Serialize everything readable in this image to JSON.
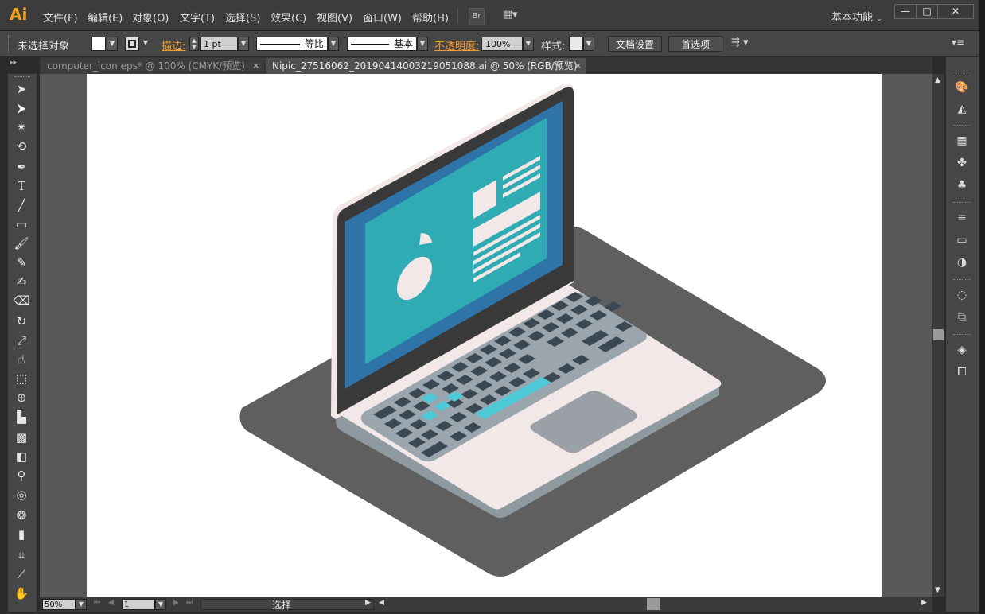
{
  "app": {
    "logo": "Ai"
  },
  "menu": [
    "文件(F)",
    "编辑(E)",
    "对象(O)",
    "文字(T)",
    "选择(S)",
    "效果(C)",
    "视图(V)",
    "窗口(W)",
    "帮助(H)"
  ],
  "menubar_buttons": {
    "bridge": "Br",
    "arrange": "▦▾"
  },
  "workspace": "基本功能",
  "window_controls": {
    "minimize": "—",
    "maximize": "□",
    "close": "✕"
  },
  "control": {
    "selection_label": "未选择对象",
    "stroke_label": "描边:",
    "stroke_weight": "1 pt",
    "profile_label": "等比",
    "brush_label": "基本",
    "opacity_label": "不透明度:",
    "opacity_value": "100%",
    "style_label": "样式:",
    "doc_setup": "文档设置",
    "preferences": "首选项"
  },
  "tabs": [
    {
      "label": "computer_icon.eps* @ 100% (CMYK/预览)",
      "active": false
    },
    {
      "label": "Nipic_27516062_20190414003219051088.ai  @  50%  (RGB/预览)",
      "active": true
    }
  ],
  "tab_close": "×",
  "tools": [
    "selection-tool",
    "direct-selection-tool",
    "magic-wand-tool",
    "lasso-tool",
    "pen-tool",
    "type-tool",
    "line-tool",
    "rectangle-tool",
    "paintbrush-tool",
    "pencil-tool",
    "blob-brush-tool",
    "eraser-tool",
    "rotate-tool",
    "scale-tool",
    "warp-tool",
    "free-transform-tool",
    "shape-builder-tool",
    "perspective-grid-tool",
    "mesh-tool",
    "gradient-tool",
    "eyedropper-tool",
    "blend-tool",
    "symbol-sprayer-tool",
    "column-graph-tool",
    "artboard-tool",
    "slice-tool",
    "hand-tool"
  ],
  "status": {
    "zoom": "50%",
    "page": "1",
    "mode": "选择"
  },
  "panels": [
    "color-icon",
    "color-guide-icon",
    "swatches-icon",
    "brushes-icon",
    "symbols-icon",
    "stroke-icon",
    "gradient-icon",
    "transparency-icon",
    "appearance-icon",
    "graphic-styles-icon",
    "layers-icon",
    "artboards-icon"
  ],
  "colors": {
    "desk": "#5f5f5f",
    "laptop_body": "#f2e8e8",
    "laptop_side": "#8e9aa0",
    "bezel": "#393939",
    "screen_frame": "#2f74a8",
    "screen": "#2eabb3",
    "keyboard_tray": "#9aa5ae",
    "key": "#3b4852",
    "key_accent": "#4fc8d8",
    "trackpad": "#9aa0a6",
    "accent_orange": "#f09a32"
  }
}
